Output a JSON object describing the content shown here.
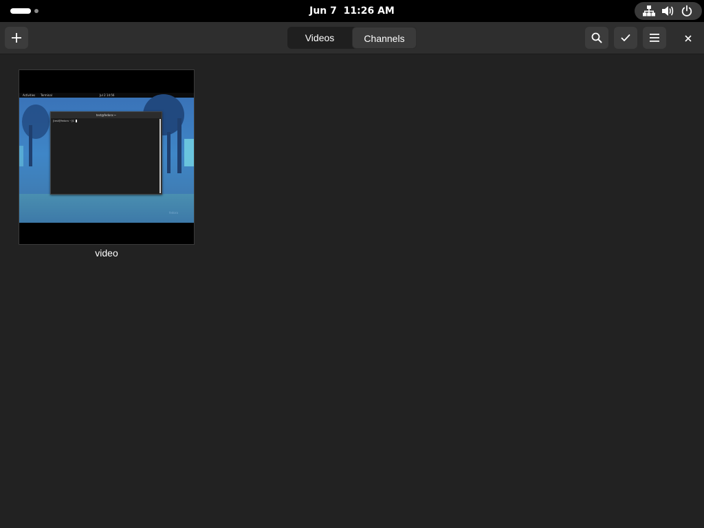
{
  "topbar": {
    "date": "Jun 7",
    "time": "11:26 AM",
    "icons": [
      "network-icon",
      "volume-icon",
      "power-icon"
    ]
  },
  "header": {
    "add_icon": "plus-icon",
    "tabs": [
      {
        "label": "Videos",
        "selected": true
      },
      {
        "label": "Channels",
        "selected": false
      }
    ],
    "search_icon": "search-icon",
    "select_icon": "checkmark-icon",
    "menu_icon": "hamburger-menu-icon",
    "close_icon": "close-icon"
  },
  "videos": [
    {
      "title": "video",
      "thumbnail": {
        "topbar_left": "Activities",
        "topbar_app": "Terminal",
        "topbar_clock": "Jul 2 14:56",
        "terminal_title": "test@fedora:~",
        "terminal_prompt": "[test@fedora ~]$",
        "logo": "fedora"
      }
    }
  ],
  "colors": {
    "topbar_bg": "#000000",
    "headerbar_bg": "#2e2e2e",
    "content_bg": "#222222",
    "button_bg": "#3c3c3c",
    "text": "#ffffff"
  }
}
